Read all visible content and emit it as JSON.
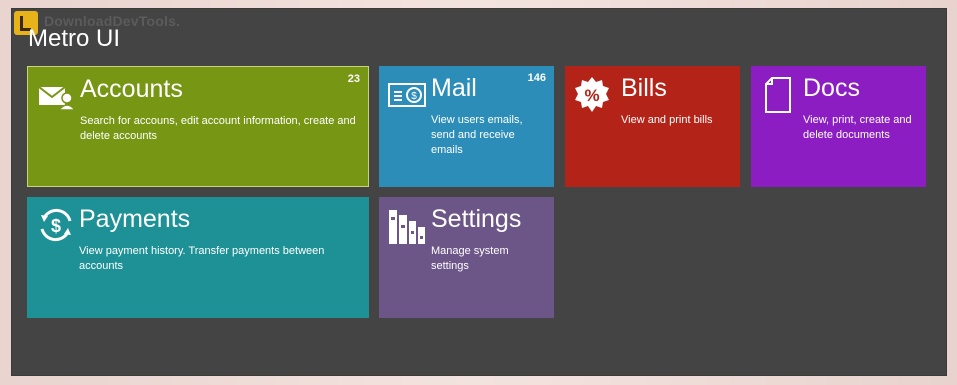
{
  "watermark": "DownloadDevTools.",
  "app": {
    "title": "Metro UI"
  },
  "tiles": {
    "accounts": {
      "title": "Accounts",
      "count": "23",
      "description": "Search for accouns, edit account information, create and delete accounts",
      "icon": "envelope-user-icon",
      "color": "#779614"
    },
    "mail": {
      "title": "Mail",
      "count": "146",
      "description": "View users emails, send and receive emails",
      "icon": "mail-money-icon",
      "color": "#2c8db9"
    },
    "bills": {
      "title": "Bills",
      "description": "View and print bills",
      "icon": "percent-badge-icon",
      "color": "#b32318"
    },
    "docs": {
      "title": "Docs",
      "description": "View, print, create and delete documents",
      "icon": "document-icon",
      "color": "#8b1dc2"
    },
    "payments": {
      "title": "Payments",
      "description": "View payment history. Transfer payments between accounts",
      "icon": "dollar-cycle-icon",
      "color": "#1d9195"
    },
    "settings": {
      "title": "Settings",
      "description": "Manage system settings",
      "icon": "bars-icon",
      "color": "#6c5587"
    }
  }
}
